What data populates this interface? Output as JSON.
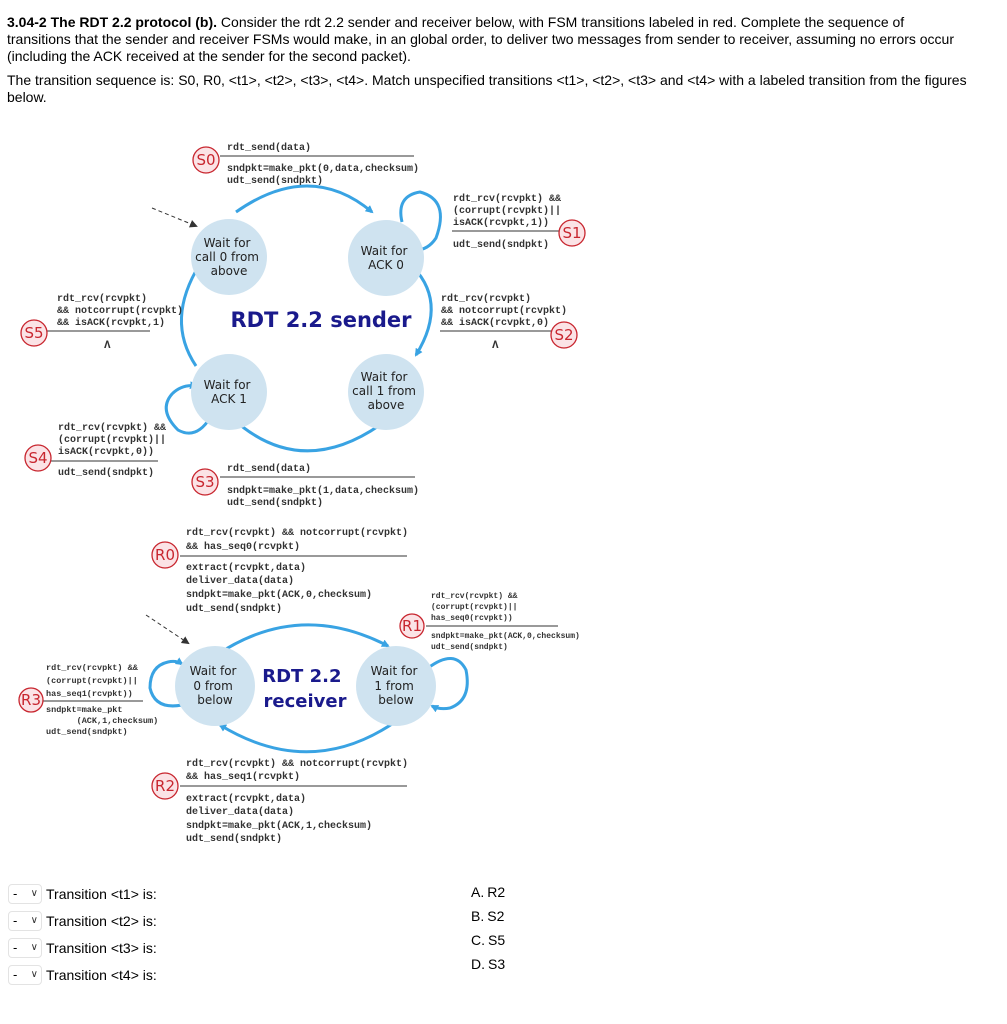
{
  "question": {
    "title": "3.04-2 The RDT 2.2 protocol (b).",
    "paragraph1": " Consider the rdt 2.2 sender and receiver below, with FSM transitions labeled in red.  Complete the sequence of transitions that the sender and receiver FSMs would make, in an global order, to deliver two messages from sender to receiver, assuming no errors occur (including the ACK received at the sender for the second packet).",
    "paragraph2": "The transition sequence is: S0, R0, <t1>, <t2>, <t3>, <t4>.  Match unspecified transitions <t1>, <t2>, <t3> and <t4> with a labeled transition from the figures below."
  },
  "sender": {
    "title": "RDT 2.2 sender",
    "states": {
      "wait_call0": [
        "Wait for",
        "call 0 from",
        "above"
      ],
      "wait_ack0": [
        "Wait for",
        "ACK 0"
      ],
      "wait_ack1": [
        "Wait for",
        "ACK 1"
      ],
      "wait_call1": [
        "Wait for",
        "call 1 from",
        "above"
      ]
    },
    "transitions": {
      "S0": {
        "label": "S0",
        "event": [
          "rdt_send(data)"
        ],
        "action": [
          "sndpkt=make_pkt(0,data,checksum)",
          "udt_send(sndpkt)"
        ]
      },
      "S1": {
        "label": "S1",
        "event": [
          "rdt_rcv(rcvpkt) &&",
          "(corrupt(rcvpkt)||",
          "isACK(rcvpkt,1))"
        ],
        "action": [
          "udt_send(sndpkt)"
        ]
      },
      "S2": {
        "label": "S2",
        "event": [
          "rdt_rcv(rcvpkt)",
          "&& notcorrupt(rcvpkt)",
          "&& isACK(rcvpkt,0)"
        ],
        "action": [
          "Λ"
        ]
      },
      "S3": {
        "label": "S3",
        "event": [
          "rdt_send(data)"
        ],
        "action": [
          "sndpkt=make_pkt(1,data,checksum)",
          "udt_send(sndpkt)"
        ]
      },
      "S4": {
        "label": "S4",
        "event": [
          "rdt_rcv(rcvpkt) &&",
          "(corrupt(rcvpkt)||",
          "isACK(rcvpkt,0))"
        ],
        "action": [
          "udt_send(sndpkt)"
        ]
      },
      "S5": {
        "label": "S5",
        "event": [
          "rdt_rcv(rcvpkt)",
          "&& notcorrupt(rcvpkt)",
          "&& isACK(rcvpkt,1)"
        ],
        "action": [
          "Λ"
        ]
      }
    }
  },
  "receiver": {
    "title": [
      "RDT 2.2",
      "receiver"
    ],
    "states": {
      "wait_0": [
        "Wait for",
        "0 from",
        "below"
      ],
      "wait_1": [
        "Wait for",
        "1 from",
        "below"
      ]
    },
    "transitions": {
      "R0": {
        "label": "R0",
        "event": [
          "rdt_rcv(rcvpkt) && notcorrupt(rcvpkt)",
          "&& has_seq0(rcvpkt)"
        ],
        "action": [
          "extract(rcvpkt,data)",
          "deliver_data(data)",
          "sndpkt=make_pkt(ACK,0,checksum)",
          "udt_send(sndpkt)"
        ]
      },
      "R1": {
        "label": "R1",
        "event": [
          "rdt_rcv(rcvpkt) &&",
          "(corrupt(rcvpkt)||",
          "has_seq0(rcvpkt))"
        ],
        "action": [
          "sndpkt=make_pkt(ACK,0,checksum)",
          "udt_send(sndpkt)"
        ]
      },
      "R2": {
        "label": "R2",
        "event": [
          "rdt_rcv(rcvpkt) && notcorrupt(rcvpkt)",
          "&& has_seq1(rcvpkt)"
        ],
        "action": [
          "extract(rcvpkt,data)",
          "deliver_data(data)",
          "sndpkt=make_pkt(ACK,1,checksum)",
          "udt_send(sndpkt)"
        ]
      },
      "R3": {
        "label": "R3",
        "event": [
          "rdt_rcv(rcvpkt) &&",
          "(corrupt(rcvpkt)||",
          "has_seq1(rcvpkt))"
        ],
        "action": [
          "sndpkt=make_pkt",
          "      (ACK,1,checksum)",
          "udt_send(sndpkt)"
        ]
      }
    }
  },
  "answers": [
    {
      "selected": "-",
      "label": "Transition <t1> is:"
    },
    {
      "selected": "-",
      "label": "Transition <t2> is:"
    },
    {
      "selected": "-",
      "label": "Transition <t3> is:"
    },
    {
      "selected": "-",
      "label": "Transition <t4> is:"
    }
  ],
  "options": [
    {
      "letter": "A.",
      "value": "R2"
    },
    {
      "letter": "B.",
      "value": "S2"
    },
    {
      "letter": "C.",
      "value": "S5"
    },
    {
      "letter": "D.",
      "value": "S3"
    }
  ],
  "icons": {
    "dropdown": "chevron-down-icon"
  },
  "colors": {
    "label_red": "#c8262f",
    "state_fill": "#cfe3f0",
    "arc_blue": "#39a3e3",
    "title_navy": "#1a1a8c"
  }
}
